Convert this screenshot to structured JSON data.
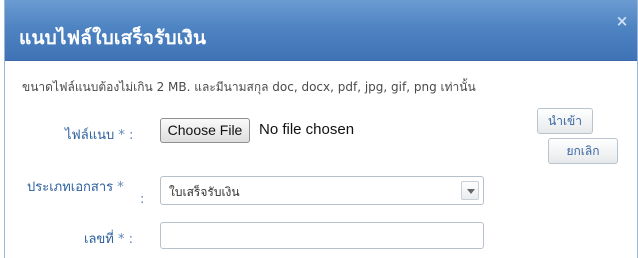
{
  "dialog": {
    "title": "แนบไฟล์ใบเสร็จรับเงิน",
    "close_glyph": "×",
    "hint": "ขนาดไฟล์แนบต้องไม่เกิน 2 MB. และมีนามสกุล doc, docx, pdf, jpg, gif, png เท่านั้น"
  },
  "form": {
    "attachment": {
      "label": "ไฟล์แนบ",
      "required_mark": "* :",
      "choose_button": "Choose File",
      "status": "No file chosen"
    },
    "doc_type": {
      "label_line1": "ประเภทเอกสาร",
      "required_mark": "*",
      "colon": ":",
      "selected": "ใบเสร็จรับเงิน"
    },
    "number": {
      "label": "เลขที่",
      "required_mark": "* :",
      "value": ""
    }
  },
  "buttons": {
    "import": "นำเข้า",
    "cancel": "ยกเลิก"
  },
  "icons": {
    "close": "close-icon",
    "dropdown": "chevron-down-icon"
  },
  "colors": {
    "titlebar": "#4f84c3",
    "label": "#2b5f9c"
  }
}
